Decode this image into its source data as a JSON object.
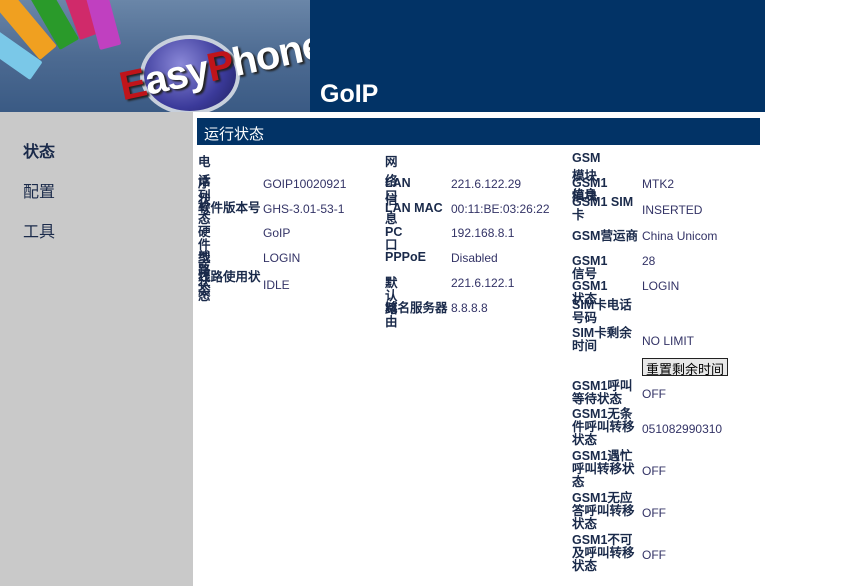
{
  "header": {
    "logo_text": "EasyPhone",
    "title": "GoIP"
  },
  "sidebar": {
    "items": [
      {
        "label": "状态"
      },
      {
        "label": "配置"
      },
      {
        "label": "工具"
      }
    ]
  },
  "main": {
    "title": "运行状态",
    "phone": {
      "heading": "电话状态",
      "rows": [
        {
          "label": "序列号",
          "value": "GOIP10020921"
        },
        {
          "label": "软件版本号",
          "value": "GHS-3.01-53-1"
        },
        {
          "label": "硬件型号",
          "value": "GoIP"
        },
        {
          "label": "线路状态",
          "value": "LOGIN"
        },
        {
          "label": "线路使用状态",
          "value": "IDLE"
        }
      ]
    },
    "network": {
      "heading": "网络信息",
      "rows": [
        {
          "label": "LAN口",
          "value": "221.6.122.29"
        },
        {
          "label": "LAN MAC",
          "value": "00:11:BE:03:26:22"
        },
        {
          "label": "PC口",
          "value": "192.168.8.1"
        },
        {
          "label": "PPPoE",
          "value": "Disabled"
        },
        {
          "label": "默认路由",
          "value": "221.6.122.1"
        },
        {
          "label": "域名服务器",
          "value": "8.8.8.8"
        }
      ]
    },
    "gsm": {
      "heading": "GSM模块信息",
      "rows": [
        {
          "label": "GSM1模块",
          "value": "MTK2"
        },
        {
          "label": "GSM1 SIM卡",
          "value": "INSERTED"
        },
        {
          "label": "GSM营运商",
          "value": "China Unicom"
        },
        {
          "label": "GSM1信号",
          "value": "28"
        },
        {
          "label": "GSM1状态",
          "value": "LOGIN"
        },
        {
          "label": "SIM卡电话号码",
          "value": ""
        },
        {
          "label": "SIM卡剩余时间",
          "value": "NO LIMIT"
        },
        {
          "label": "GSM1呼叫等待状态",
          "value": "OFF"
        },
        {
          "label": "GSM1无条件呼叫转移状态",
          "value": "051082990310"
        },
        {
          "label": "GSM1遇忙呼叫转移状态",
          "value": "OFF"
        },
        {
          "label": "GSM1无应答呼叫转移状态",
          "value": "OFF"
        },
        {
          "label": "GSM1不可及呼叫转移状态",
          "value": "OFF"
        }
      ],
      "reset_button": "重置剩余时间"
    }
  }
}
